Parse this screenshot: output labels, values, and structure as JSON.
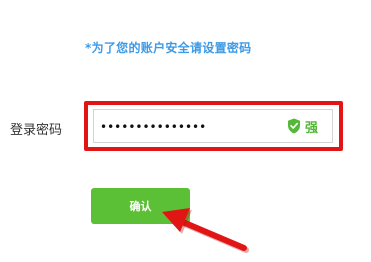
{
  "notice": "*为了您的账户安全请设置密码",
  "form": {
    "password_label": "登录密码",
    "password_value": "•••••••••••••••",
    "strength_label": "强",
    "confirm_label": "确认"
  },
  "colors": {
    "notice": "#3d9ae6",
    "highlight": "#e21515",
    "button": "#5bc035",
    "strength": "#55b839",
    "arrow": "#e21515"
  },
  "icons": {
    "strength": "shield-check-icon",
    "annotation": "red-arrow-icon"
  }
}
